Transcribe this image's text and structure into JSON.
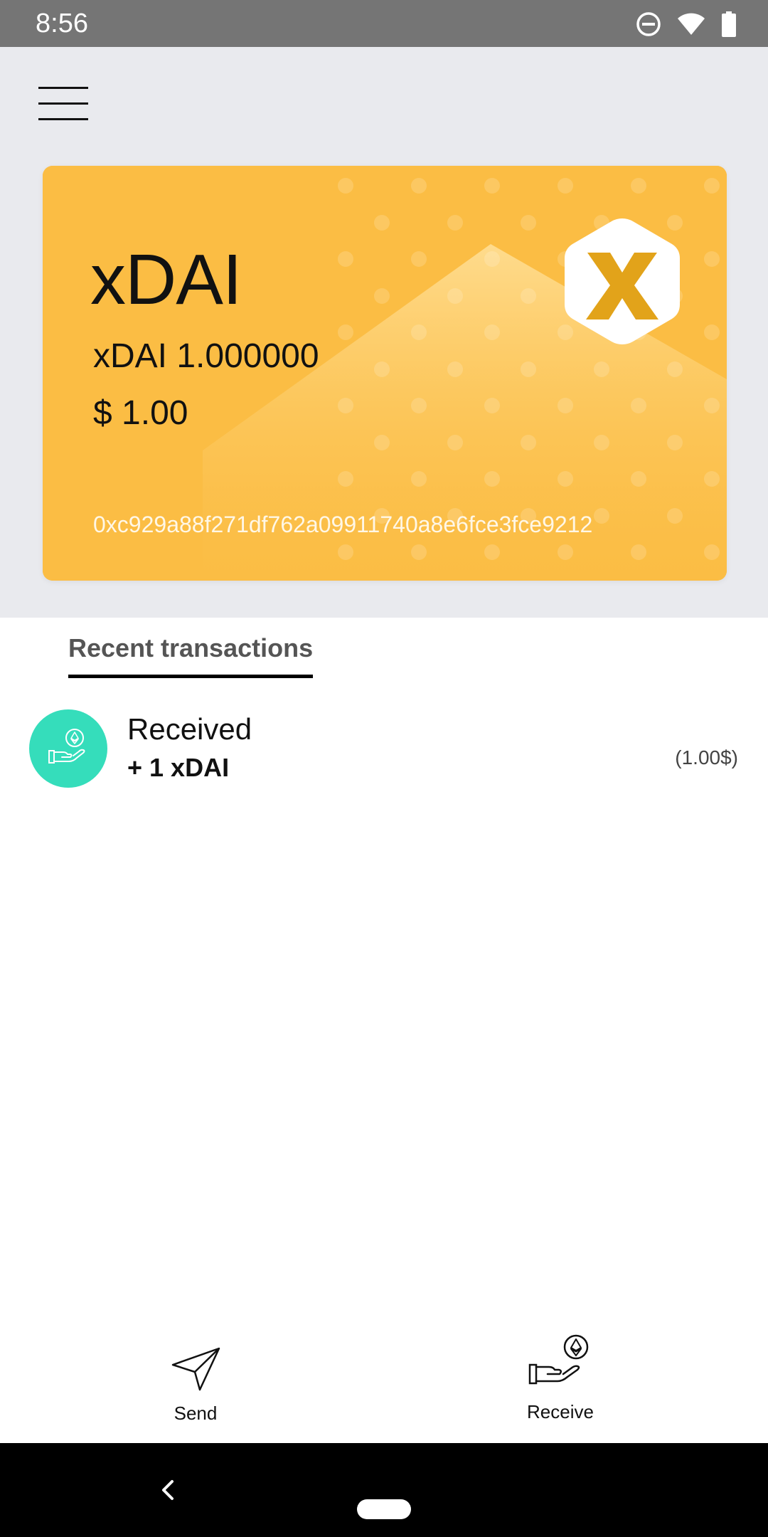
{
  "status_bar": {
    "time": "8:56",
    "icons": [
      "do-not-disturb-icon",
      "wifi-icon",
      "battery-icon"
    ]
  },
  "header": {
    "menu_icon": "hamburger-menu-icon"
  },
  "card": {
    "token_name": "xDAI",
    "balance": "xDAI 1.000000",
    "fiat_value": "$ 1.00",
    "address": "0xc929a88f271df762a09911740a8e6fce3fce9212",
    "logo_icon": "xdai-logo-icon",
    "colors": {
      "card_bg": "#fbbd44",
      "logo_mark": "#e2a31a"
    }
  },
  "tabs": [
    {
      "label": "Recent transactions",
      "active": true
    }
  ],
  "transactions": [
    {
      "type": "Received",
      "amount": "+ 1 xDAI",
      "fiat": "(1.00$)",
      "icon": "receive-hand-icon",
      "icon_bg": "#35ddbb"
    }
  ],
  "actions": {
    "send_label": "Send",
    "send_icon": "paper-plane-icon",
    "receive_label": "Receive",
    "receive_icon": "receive-hand-icon"
  },
  "nav_bar": {
    "back_icon": "back-chevron-icon",
    "home_icon": "home-pill-icon"
  }
}
